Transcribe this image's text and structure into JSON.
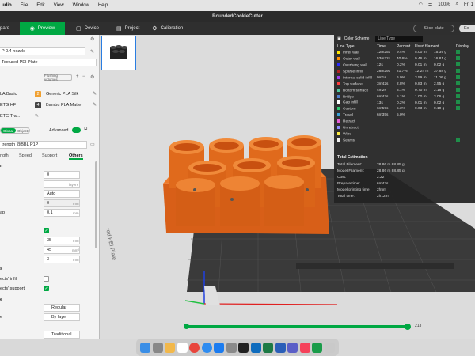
{
  "menubar": {
    "app": "udio",
    "items": [
      "File",
      "Edit",
      "View",
      "Window",
      "Help"
    ],
    "battery": "100%",
    "clock": "Fri 1"
  },
  "window": {
    "title": "RoundedCookieCutter"
  },
  "toolbar": {
    "tabs": [
      {
        "label": "pare",
        "active": false
      },
      {
        "label": "Preview",
        "active": true
      },
      {
        "label": "Device",
        "active": false
      },
      {
        "label": "Project",
        "active": false
      },
      {
        "label": "Calibration",
        "active": false
      }
    ],
    "slice_label": "Slice plate",
    "export_label": "Ex"
  },
  "sidebar": {
    "nozzle": "P 0.4 nozzle",
    "plate": "Textured PEI Plate",
    "flushing_label": "Flushing volumes",
    "filaments": [
      {
        "num": "2",
        "color": "#f0a030",
        "name": "LA Basic",
        "name2": "Generic PLA Silk"
      },
      {
        "num": "4",
        "color": "#444444",
        "name": "ETG HF",
        "name2": "Bambu PLA Matte"
      },
      {
        "num": "",
        "color": "",
        "name": "ETG Tra...",
        "name2": ""
      }
    ],
    "mode_global": "Global",
    "mode_objects": "Objects",
    "advanced_label": "Advanced",
    "process": "trength @BBL P1P",
    "tabs": [
      "ngth",
      "Speed",
      "Support",
      "Others"
    ],
    "sections": {
      "s1": "n",
      "s2": "s",
      "s3": "e"
    },
    "fields": {
      "val_0": "0",
      "layers_unit": "layers",
      "auto": "Auto",
      "val_0b": "0",
      "mm": "mm",
      "gap_label": "ap",
      "val_01": "0.1",
      "val_35": "35",
      "val_45": "45",
      "mm2": "mm²",
      "val_3": "3",
      "infill_label": "ects' infill",
      "support_label": "ects' support",
      "regular": "Regular",
      "by_layer": "By layer",
      "traditional": "Traditional",
      "e_label": "e"
    }
  },
  "viewport": {
    "plate_text": "red PEI Plate",
    "layer_top": "213"
  },
  "legend": {
    "header": "Color Scheme",
    "scheme": "Line Type",
    "columns": [
      "Line Type",
      "Time",
      "Percent",
      "Used filament",
      "Display"
    ],
    "rows": [
      {
        "name": "Inner wall",
        "color": "#ffe600",
        "time": "12m25s",
        "pct": "9.4%",
        "len": "5.00 m",
        "wt": "15.39 g",
        "check": true
      },
      {
        "name": "Outer wall",
        "color": "#ff8c00",
        "time": "53m22s",
        "pct": "40.6%",
        "len": "9.46 m",
        "wt": "16.81 g",
        "check": true
      },
      {
        "name": "Overhang wall",
        "color": "#2828ff",
        "time": "12s",
        "pct": "0.2%",
        "len": "0.01 m",
        "wt": "0.02 g",
        "check": true
      },
      {
        "name": "Sparse infill",
        "color": "#b22222",
        "time": "28m29s",
        "pct": "21.7%",
        "len": "12.24 m",
        "wt": "37.68 g",
        "check": true
      },
      {
        "name": "Internal solid infill",
        "color": "#9c3ff0",
        "time": "9m1s",
        "pct": "6.9%",
        "len": "3.59 m",
        "wt": "11.06 g",
        "check": true
      },
      {
        "name": "Top surface",
        "color": "#ff3c3c",
        "time": "3m42s",
        "pct": "2.8%",
        "len": "0.83 m",
        "wt": "2.55 g",
        "check": true
      },
      {
        "name": "Bottom surface",
        "color": "#50c8a0",
        "time": "4m2s",
        "pct": "3.1%",
        "len": "0.70 m",
        "wt": "2.16 g",
        "check": true
      },
      {
        "name": "Bridge",
        "color": "#4f7fd0",
        "time": "6m42s",
        "pct": "5.1%",
        "len": "1.00 m",
        "wt": "3.06 g",
        "check": true
      },
      {
        "name": "Gap infill",
        "color": "#ffffff",
        "time": "13s",
        "pct": "0.2%",
        "len": "0.01 m",
        "wt": "0.02 g",
        "check": true
      },
      {
        "name": "Custom",
        "color": "#2ecc71",
        "time": "6m59s",
        "pct": "5.3%",
        "len": "0.03 m",
        "wt": "0.10 g",
        "check": true
      },
      {
        "name": "Travel",
        "color": "#38a0d8",
        "time": "6m35s",
        "pct": "5.0%",
        "len": "",
        "wt": "",
        "check": false
      },
      {
        "name": "Retract",
        "color": "#e65cd9",
        "time": "",
        "pct": "",
        "len": "",
        "wt": "",
        "check": false
      },
      {
        "name": "Unretract",
        "color": "#8b8bff",
        "time": "",
        "pct": "",
        "len": "",
        "wt": "",
        "check": false
      },
      {
        "name": "Wipe",
        "color": "#ffee44",
        "time": "",
        "pct": "",
        "len": "",
        "wt": "",
        "check": false
      },
      {
        "name": "Seams",
        "color": "#f0f0f0",
        "time": "",
        "pct": "",
        "len": "",
        "wt": "",
        "check": true
      }
    ],
    "estimation_title": "Total Estimation",
    "estimation": [
      {
        "label": "Total Filament:",
        "value": "28.86 m    88.85 g"
      },
      {
        "label": "Model Filament:",
        "value": "28.86 m    88.85 g"
      },
      {
        "label": "Cost:",
        "value": "2.22"
      },
      {
        "label": "Prepare time:",
        "value": "6m43s"
      },
      {
        "label": "Model printing time:",
        "value": "2h5m"
      },
      {
        "label": "Total time:",
        "value": "2h12m"
      }
    ]
  },
  "colors": {
    "accent": "#00a843",
    "model": "#e2661a",
    "bed": "#3c3c3c"
  }
}
